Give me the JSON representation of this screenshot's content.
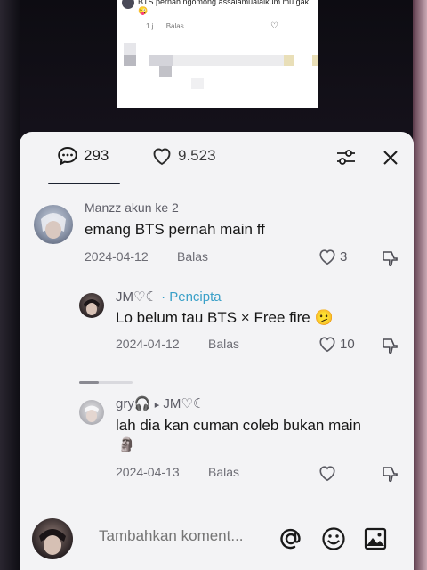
{
  "inner_screenshot": {
    "text": "BTS pernah ngomong assalamualaikum mu gak 😜",
    "time": "1 j",
    "reply": "Balas"
  },
  "tabs": {
    "comments_count": "293",
    "likes_count": "9.523"
  },
  "comments": [
    {
      "username": "Manzz akun ke 2",
      "text": "emang BTS pernah main ff",
      "date": "2024-04-12",
      "reply": "Balas",
      "likes": "3"
    },
    {
      "username": "JM♡☾",
      "creator_tag": "· Pencipta",
      "text": "Lo belum tau BTS × Free fire 🫤",
      "date": "2024-04-12",
      "reply": "Balas",
      "likes": "10"
    },
    {
      "username": "gry🎧",
      "reply_arrow": "▸",
      "reply_to": "JM♡☾",
      "text_line1": "lah dia kan cuman coleb bukan main",
      "text_line2": "🗿",
      "date": "2024-04-13",
      "reply": "Balas",
      "likes": ""
    }
  ],
  "input": {
    "placeholder": "Tambahkan koment..."
  },
  "icons": {
    "comments": "comment-bubble-icon",
    "likes": "heart-icon",
    "filter": "filter-sliders-icon",
    "close": "close-icon",
    "mention": "at-mention-icon",
    "emoji": "emoji-icon",
    "image": "image-icon"
  },
  "colors": {
    "creator_tag": "#3aa0c8",
    "sheet_bg": "#f3f3f5",
    "text": "#161616"
  }
}
